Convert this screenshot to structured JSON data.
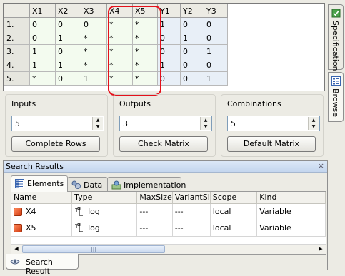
{
  "matrix": {
    "columns": [
      "X1",
      "X2",
      "X3",
      "X4",
      "X5",
      "Y1",
      "Y2",
      "Y3"
    ],
    "rows": [
      {
        "label": "1.",
        "cells": [
          "0",
          "0",
          "0",
          "*",
          "*",
          "1",
          "0",
          "0"
        ]
      },
      {
        "label": "2.",
        "cells": [
          "0",
          "1",
          "*",
          "*",
          "*",
          "0",
          "1",
          "0"
        ]
      },
      {
        "label": "3.",
        "cells": [
          "1",
          "0",
          "*",
          "*",
          "*",
          "0",
          "0",
          "1"
        ]
      },
      {
        "label": "4.",
        "cells": [
          "1",
          "1",
          "*",
          "*",
          "*",
          "1",
          "0",
          "0"
        ]
      },
      {
        "label": "5.",
        "cells": [
          "*",
          "0",
          "1",
          "*",
          "*",
          "0",
          "0",
          "1"
        ]
      }
    ]
  },
  "side_tabs": {
    "specification": "Specification",
    "browse": "Browse"
  },
  "inputs": {
    "title": "Inputs",
    "value": "5",
    "button": "Complete Rows"
  },
  "outputs": {
    "title": "Outputs",
    "value": "3",
    "button": "Check Matrix"
  },
  "combinations": {
    "title": "Combinations",
    "value": "5",
    "button": "Default Matrix"
  },
  "search": {
    "title": "Search Results",
    "close": "×",
    "tabs": [
      "Elements",
      "Data",
      "Implementation"
    ],
    "columns": [
      "Name",
      "Type",
      "MaxSize",
      "VariantSi",
      "Scope",
      "Kind"
    ],
    "rows": [
      {
        "name": "X4",
        "type": "log",
        "maxsize": "---",
        "variant": "---",
        "scope": "local",
        "kind": "Variable"
      },
      {
        "name": "X5",
        "type": "log",
        "maxsize": "---",
        "variant": "---",
        "scope": "local",
        "kind": "Variable"
      }
    ],
    "scroll_grip": "|||",
    "bottom_tab": "Search Result"
  },
  "colors": {
    "highlight": "#e4101b",
    "input_cells": "#f3fbef",
    "output_cells": "#e8eff7",
    "panel_header": "#c4d6ee"
  }
}
